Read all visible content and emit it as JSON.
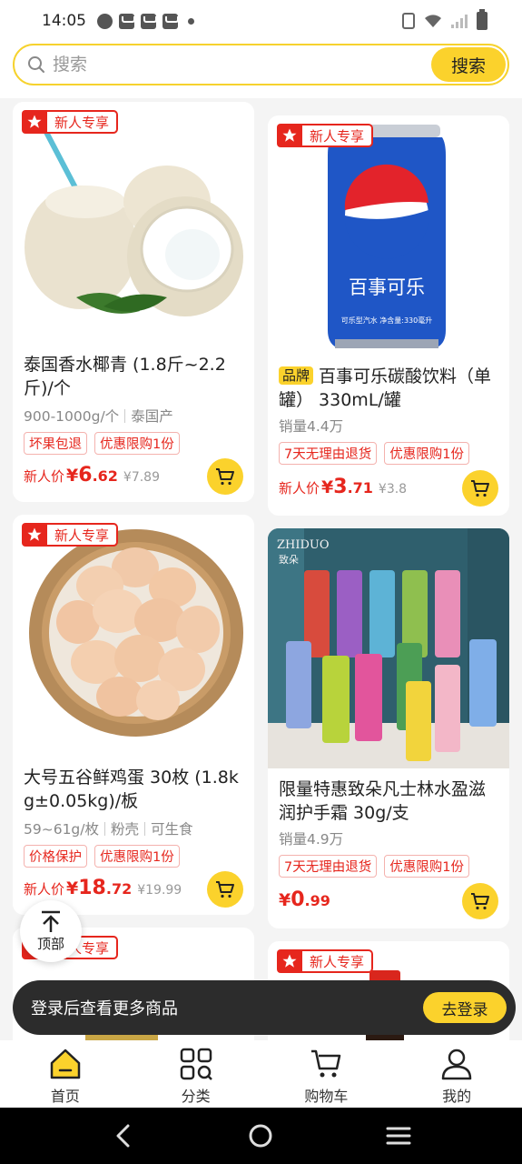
{
  "status_bar": {
    "time": "14:05"
  },
  "search": {
    "placeholder": "搜索",
    "button_label": "搜索"
  },
  "products": [
    {
      "badge": "新人专享",
      "title": "泰国香水椰青 (1.8斤~2.2斤)/个",
      "specs": [
        "900-1000g/个",
        "泰国产"
      ],
      "tags": [
        "坏果包退",
        "优惠限购1份"
      ],
      "price_label": "新人价",
      "price_symbol": "¥",
      "price_int": "6",
      "price_dec": ".62",
      "price_old": "¥7.89"
    },
    {
      "badge": "新人专享",
      "brand_tag": "品牌",
      "title": "百事可乐碳酸饮料（单罐） 330mL/罐",
      "sales": "销量4.4万",
      "tags": [
        "7天无理由退货",
        "优惠限购1份"
      ],
      "price_label": "新人价",
      "price_symbol": "¥",
      "price_int": "3",
      "price_dec": ".71",
      "price_old": "¥3.8",
      "can_text": "百事可乐",
      "can_small": "可乐型汽水  净含量:330毫升"
    },
    {
      "badge": "新人专享",
      "title": "大号五谷鲜鸡蛋 30枚 (1.8kg±0.05kg)/板",
      "specs": [
        "59~61g/枚",
        "粉壳",
        "可生食"
      ],
      "tags": [
        "价格保护",
        "优惠限购1份"
      ],
      "price_label": "新人价",
      "price_symbol": "¥",
      "price_int": "18",
      "price_dec": ".72",
      "price_old": "¥19.99"
    },
    {
      "brand_logo": "ZHIDUO",
      "brand_logo_cn": "致朵",
      "title": "限量特惠致朵凡士林水盈滋润护手霜 30g/支",
      "sales": "销量4.9万",
      "tags": [
        "7天无理由退货",
        "优惠限购1份"
      ],
      "price_symbol": "¥",
      "price_int": "0",
      "price_dec": ".99"
    },
    {
      "badge": "新人专享"
    },
    {
      "badge": "新人专享"
    }
  ],
  "top_button": {
    "label": "顶部"
  },
  "login_banner": {
    "text": "登录后查看更多商品",
    "button_label": "去登录"
  },
  "bottom_nav": [
    {
      "label": "首页",
      "icon": "home-icon",
      "active": true
    },
    {
      "label": "分类",
      "icon": "category-icon",
      "active": false
    },
    {
      "label": "购物车",
      "icon": "cart-icon",
      "active": false
    },
    {
      "label": "我的",
      "icon": "profile-icon",
      "active": false
    }
  ],
  "colors": {
    "accent": "#fbd22c",
    "price_red": "#e6261d",
    "pepsi_blue": "#1f56c6"
  }
}
